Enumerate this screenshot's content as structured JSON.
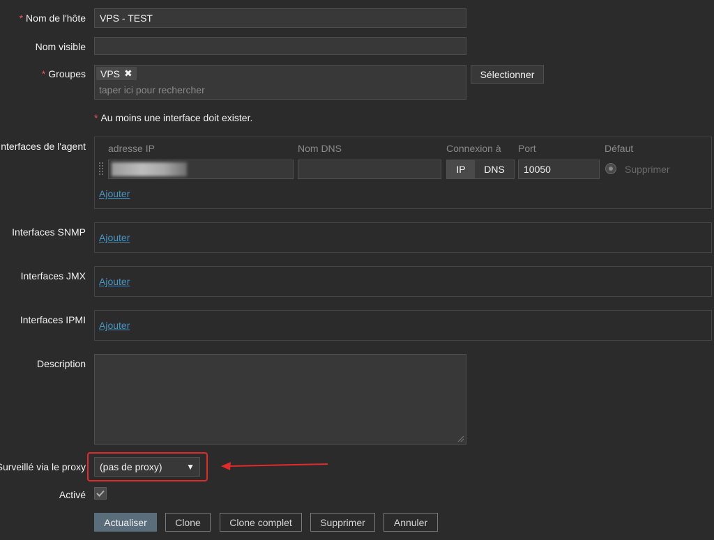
{
  "form": {
    "hostname": {
      "label": "Nom de l'hôte",
      "value": "VPS - TEST"
    },
    "visible_name": {
      "label": "Nom visible",
      "value": ""
    },
    "groups": {
      "label": "Groupes",
      "tag": "VPS",
      "placeholder": "taper ici pour rechercher",
      "select_label": "Sélectionner"
    },
    "interface_notice": "Au moins une interface doit exister.",
    "agent_interfaces": {
      "label": "Interfaces de l'agent",
      "headers": {
        "ip": "adresse IP",
        "dns": "Nom DNS",
        "connect": "Connexion à",
        "port": "Port",
        "default": "Défaut"
      },
      "row": {
        "ip": "",
        "dns": "",
        "connect_ip": "IP",
        "connect_dns": "DNS",
        "port": "10050",
        "remove": "Supprimer"
      },
      "add": "Ajouter"
    },
    "snmp": {
      "label": "Interfaces SNMP",
      "add": "Ajouter"
    },
    "jmx": {
      "label": "Interfaces JMX",
      "add": "Ajouter"
    },
    "ipmi": {
      "label": "Interfaces IPMI",
      "add": "Ajouter"
    },
    "description": {
      "label": "Description",
      "value": ""
    },
    "proxy": {
      "label": "Surveillé via le proxy",
      "selected": "(pas de proxy)"
    },
    "enabled": {
      "label": "Activé",
      "checked": true
    }
  },
  "actions": {
    "update": "Actualiser",
    "clone": "Clone",
    "full_clone": "Clone complet",
    "delete": "Supprimer",
    "cancel": "Annuler"
  },
  "colors": {
    "required": "#e45959",
    "link": "#4796c4",
    "annotation": "#e32a2a",
    "primary": "#5a6d7b"
  },
  "required_marker": "*"
}
